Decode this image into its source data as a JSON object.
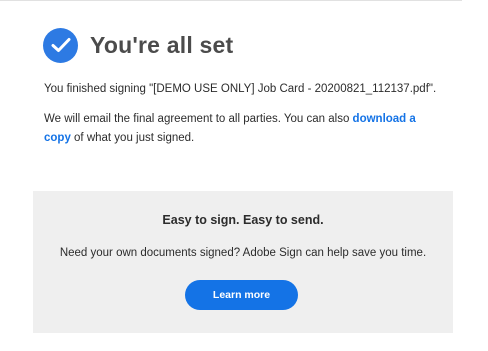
{
  "colors": {
    "accent": "#1473e6",
    "check_circle": "#2d7ae3",
    "promo_background": "#efefef",
    "text": "#2c2c2c",
    "title": "#4b4b4b"
  },
  "header": {
    "icon": "checkmark-circle-icon",
    "title": "You're all set"
  },
  "message": {
    "signed_text": "You finished signing \"[DEMO USE ONLY] Job Card - 20200821_112137.pdf\".",
    "email_text_before": "We will email the final agreement to all parties. You can also ",
    "download_link": "download a copy",
    "email_text_after": " of what you just signed."
  },
  "promo": {
    "title": "Easy to sign. Easy to send.",
    "text": "Need your own documents signed? Adobe Sign can help save you time.",
    "button_label": "Learn more"
  }
}
